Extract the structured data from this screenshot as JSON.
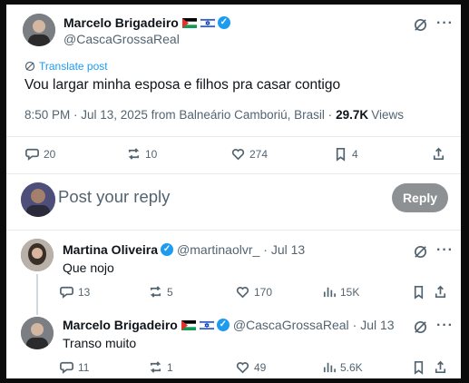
{
  "main_post": {
    "author_name": "Marcelo Brigadeiro",
    "handle": "@CascaGrossaReal",
    "translate_label": "Translate post",
    "text": "Vou largar minha esposa e filhos pra casar contigo",
    "meta_time": "8:50 PM · Jul 13, 2025 from Balneário Camboriú, Brasil ·",
    "views_count": "29.7K",
    "views_label": "Views",
    "actions": {
      "replies": "20",
      "reposts": "10",
      "likes": "274",
      "bookmarks": "4"
    }
  },
  "composer": {
    "placeholder": "Post your reply",
    "reply_button": "Reply"
  },
  "replies": [
    {
      "author_name": "Martina Oliveira",
      "handle": "@martinaolvr_",
      "date": "· Jul 13",
      "text": "Que nojo",
      "actions": {
        "replies": "13",
        "reposts": "5",
        "likes": "170",
        "views": "15K"
      }
    },
    {
      "author_name": "Marcelo Brigadeiro",
      "handle": "@CascaGrossaReal",
      "date": "· Jul 13",
      "text": "Transo muito",
      "actions": {
        "replies": "11",
        "reposts": "1",
        "likes": "49",
        "views": "5.6K"
      }
    }
  ],
  "colors": {
    "accent": "#1d9bf0",
    "reply_button_bg": "#8d9194",
    "muted": "#536471"
  },
  "icons": [
    "verified-icon",
    "grok-icon",
    "more-icon",
    "translate-icon",
    "reply-icon",
    "repost-icon",
    "like-icon",
    "bookmark-icon",
    "share-icon",
    "views-icon"
  ]
}
